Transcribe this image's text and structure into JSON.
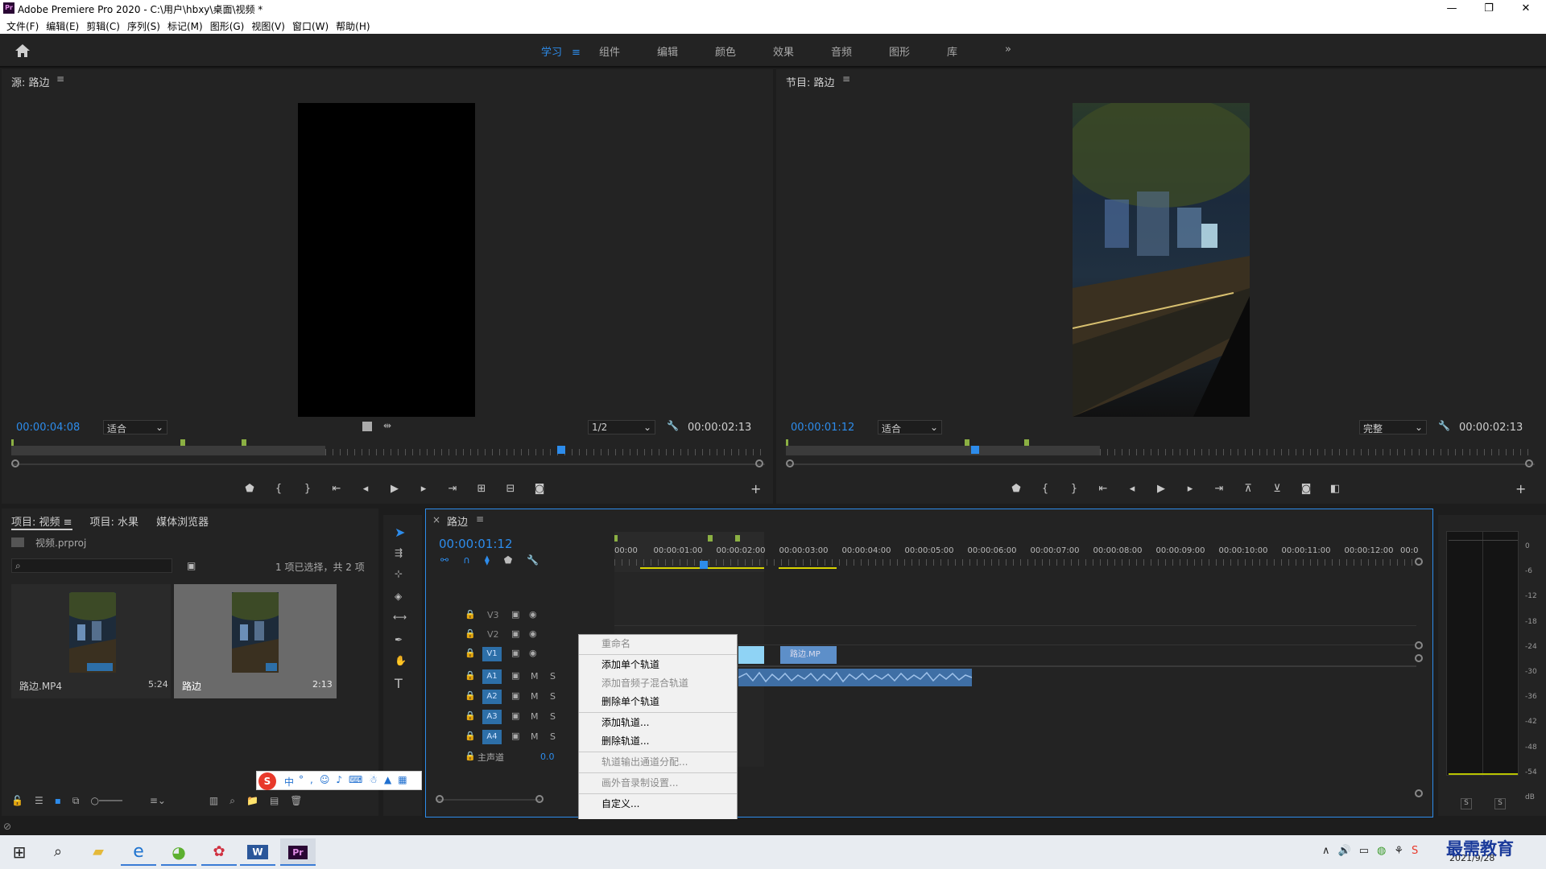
{
  "window": {
    "title": "Adobe Premiere Pro 2020 - C:\\用户\\hbxy\\桌面\\视频 *",
    "logo": "Pr"
  },
  "menu": [
    "文件(F)",
    "编辑(E)",
    "剪辑(C)",
    "序列(S)",
    "标记(M)",
    "图形(G)",
    "视图(V)",
    "窗口(W)",
    "帮助(H)"
  ],
  "workspaces": {
    "tabs": [
      "学习",
      "组件",
      "编辑",
      "颜色",
      "效果",
      "音频",
      "图形",
      "库"
    ],
    "active": "学习",
    "more": "»"
  },
  "source_monitor": {
    "title": "源: 路边",
    "timecode": "00:00:04:08",
    "fit": "适合",
    "resolution": "1/2",
    "duration": "00:00:02:13"
  },
  "program_monitor": {
    "title": "节目: 路边",
    "timecode": "00:00:01:12",
    "fit": "适合",
    "quality": "完整",
    "duration": "00:00:02:13"
  },
  "project_panel": {
    "tabs": [
      "项目: 视频",
      "项目: 水果",
      "媒体浏览器"
    ],
    "project_file": "视频.prproj",
    "selection_status": "1 项已选择，共 2 项",
    "items": [
      {
        "name": "路边.MP4",
        "duration": "5:24",
        "selected": false
      },
      {
        "name": "路边",
        "duration": "2:13",
        "selected": true
      }
    ]
  },
  "timeline": {
    "sequence_name": "路边",
    "timecode": "00:00:01:12",
    "ruler": [
      "00:00",
      "00:00:01:00",
      "00:00:02:00",
      "00:00:03:00",
      "00:00:04:00",
      "00:00:05:00",
      "00:00:06:00",
      "00:00:07:00",
      "00:00:08:00",
      "00:00:09:00",
      "00:00:10:00",
      "00:00:11:00",
      "00:00:12:00",
      "00:0"
    ],
    "video_tracks": [
      "V3",
      "V2",
      "V1"
    ],
    "audio_tracks": [
      "A1",
      "A2",
      "A3",
      "A4"
    ],
    "master": {
      "label": "主声道",
      "value": "0.0"
    },
    "clip_label": "路边.MP",
    "mute": "M",
    "solo": "S"
  },
  "context_menu": {
    "items": [
      {
        "label": "重命名",
        "enabled": false
      },
      {
        "sep": true
      },
      {
        "label": "添加单个轨道",
        "enabled": true
      },
      {
        "label": "添加音频子混合轨道",
        "enabled": false
      },
      {
        "label": "删除单个轨道",
        "enabled": true
      },
      {
        "sep": true
      },
      {
        "label": "添加轨道...",
        "enabled": true
      },
      {
        "label": "删除轨道...",
        "enabled": true
      },
      {
        "sep": true
      },
      {
        "label": "轨道输出通道分配...",
        "enabled": false
      },
      {
        "sep": true
      },
      {
        "label": "画外音录制设置...",
        "enabled": false
      },
      {
        "sep": true
      },
      {
        "label": "自定义...",
        "enabled": true
      }
    ]
  },
  "audio_meter": {
    "scale": [
      "0",
      "-6",
      "-12",
      "-18",
      "-24",
      "-30",
      "-36",
      "-42",
      "-48",
      "-54",
      "dB"
    ],
    "solo": [
      "S",
      "S"
    ]
  },
  "ime_toolbar": {
    "mode": "中"
  },
  "taskbar": {
    "date": "2021/9/28",
    "watermark": "最需教育"
  },
  "colors": {
    "accent": "#2d8ceb",
    "track_active": "#2d6fa8",
    "clip_video": "#8fd3f5",
    "clip_audio": "#5d8fc9",
    "marker": "#8bb043"
  }
}
